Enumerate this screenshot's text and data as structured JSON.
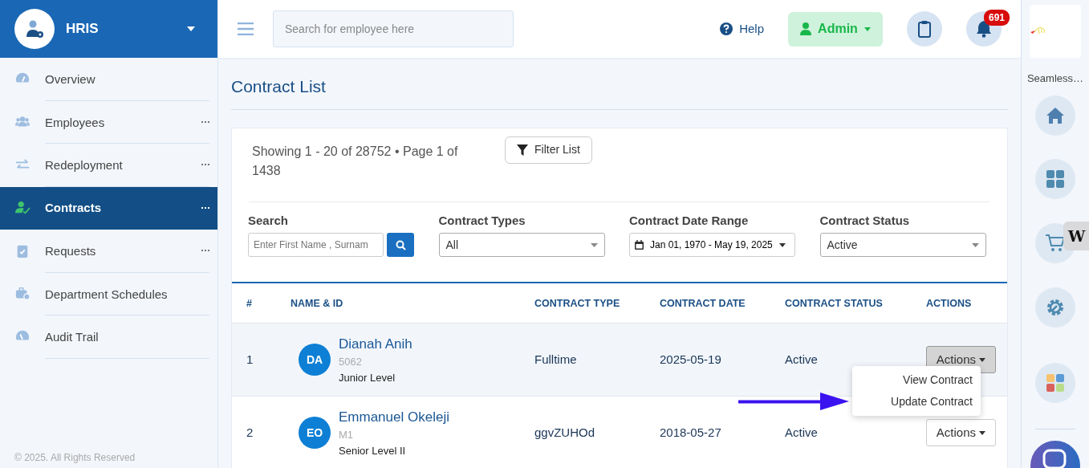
{
  "brand": {
    "title": "HRIS"
  },
  "sidebar": {
    "items": [
      {
        "label": "Overview",
        "more": false,
        "selected": false
      },
      {
        "label": "Employees",
        "more": true,
        "selected": false
      },
      {
        "label": "Redeployment",
        "more": true,
        "selected": false
      },
      {
        "label": "Contracts",
        "more": true,
        "selected": true
      },
      {
        "label": "Requests",
        "more": true,
        "selected": false
      },
      {
        "label": "Department Schedules",
        "more": false,
        "selected": false
      },
      {
        "label": "Audit Trail",
        "more": false,
        "selected": false
      }
    ],
    "footer": "© 2025. All Rights Reserved"
  },
  "topbar": {
    "search": {
      "placeholder": "Search for employee here"
    },
    "help": "Help",
    "user": "Admin",
    "notifications": "691"
  },
  "right_rail": {
    "app_name": "Seamless…",
    "extension_tab": "W"
  },
  "page": {
    "title": "Contract List"
  },
  "summary": "Showing 1 - 20 of 28752 • Page 1 of 1438",
  "filter_button": "Filter List",
  "filters": [
    {
      "kind": "search",
      "label": "Search",
      "placeholder": "Enter First Name , Surnam"
    },
    {
      "kind": "select",
      "label": "Contract Types",
      "value": "All"
    },
    {
      "kind": "daterange",
      "label": "Contract Date Range",
      "value": "Jan 01, 1970 - May 19, 2025"
    },
    {
      "kind": "select",
      "label": "Contract Status",
      "value": "Active"
    }
  ],
  "table": {
    "columns": [
      "#",
      "NAME & ID",
      "CONTRACT TYPE",
      "CONTRACT DATE",
      "CONTRACT STATUS",
      "ACTIONS"
    ],
    "rows": [
      {
        "index": "1",
        "initials": "DA",
        "name": "Dianah Anih",
        "id": "5062",
        "level": "Junior Level",
        "contract_type": "Fulltime",
        "contract_date": "2025-05-19",
        "status": "Active",
        "action": "Actions",
        "expanded": true
      },
      {
        "index": "2",
        "initials": "EO",
        "name": "Emmanuel Okeleji",
        "id": "M1",
        "level": "Senior Level II",
        "contract_type": "ggvZUHOd",
        "contract_date": "2018-05-27",
        "status": "Active",
        "action": "Actions",
        "expanded": false
      }
    ]
  },
  "actions_menu": {
    "items": [
      "View Contract",
      "Update Contract"
    ]
  }
}
